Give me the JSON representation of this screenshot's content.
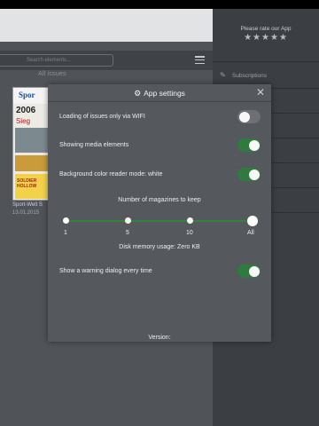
{
  "sidebar": {
    "rate_text": "Please rate our App",
    "stars": "★★★★★",
    "items": [
      {
        "label": "Subscriptions"
      }
    ]
  },
  "main": {
    "search_placeholder": "Search elements…",
    "section_title": "All issues",
    "issue": {
      "title": "Sport-Welt S",
      "date": "13.01.2015",
      "cover_texts": [
        "Spor",
        "2006",
        "Sieg",
        "SOLDIER HOLLOW"
      ]
    }
  },
  "settings": {
    "title": "App settings",
    "rows": [
      {
        "label": "Loading of issues only via WIFI",
        "on": false
      },
      {
        "label": "Showing media elements",
        "on": true
      },
      {
        "label": "Background color reader mode: white",
        "on": true
      }
    ],
    "keep_title": "Number of magazines to keep",
    "keep_options": [
      "1",
      "5",
      "10",
      "All"
    ],
    "keep_selected": "All",
    "disk_usage": "Disk memory usage: Zero KB",
    "warning": {
      "label": "Show a warning dialog every time",
      "on": true
    },
    "version": "Version:"
  },
  "colors": {
    "accent_green": "#2f7b3f",
    "panel_dark": "#3b3e43",
    "modal_bg": "#55585c"
  }
}
